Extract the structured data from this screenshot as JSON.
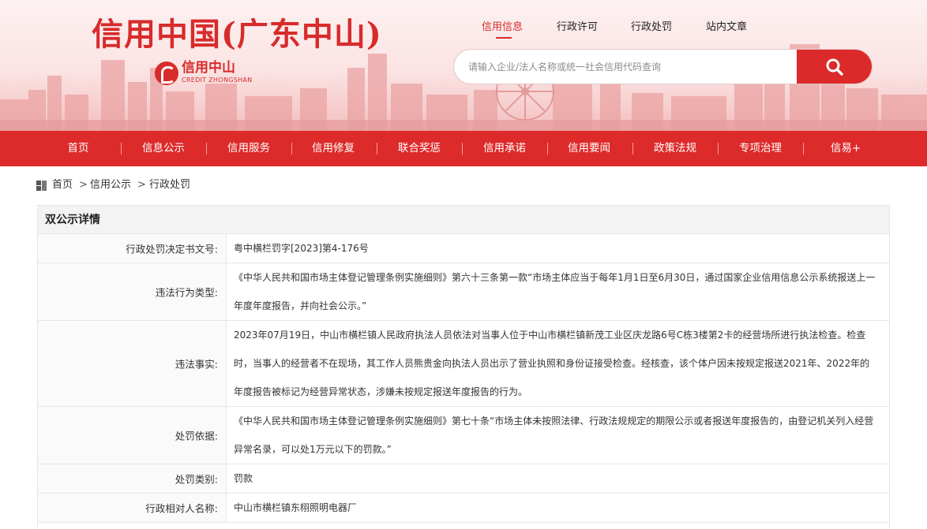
{
  "site": {
    "title": "信用中国(广东中山)",
    "logo_cn": "信用中山",
    "logo_en": "CREDIT ZHONGSHAN"
  },
  "top_links": [
    {
      "label": "信用信息",
      "active": true
    },
    {
      "label": "行政许可",
      "active": false
    },
    {
      "label": "行政处罚",
      "active": false
    },
    {
      "label": "站内文章",
      "active": false
    }
  ],
  "search": {
    "placeholder": "请输入企业/法人名称或统一社会信用代码查询",
    "icon": "search-icon"
  },
  "nav": [
    {
      "label": "首页"
    },
    {
      "label": "信息公示"
    },
    {
      "label": "信用服务"
    },
    {
      "label": "信用修复"
    },
    {
      "label": "联合奖惩"
    },
    {
      "label": "信用承诺"
    },
    {
      "label": "信用要闻"
    },
    {
      "label": "政策法规"
    },
    {
      "label": "专项治理"
    },
    {
      "label": "信易+"
    }
  ],
  "breadcrumb": {
    "icon": "grid-icon",
    "items": [
      "首页",
      "信用公示",
      "行政处罚"
    ],
    "separator": ">"
  },
  "panel": {
    "title": "双公示详情",
    "rows": [
      {
        "label": "行政处罚决定书文号:",
        "value": "粤中横栏罚字[2023]第4-176号"
      },
      {
        "label": "违法行为类型:",
        "value": "《中华人民共和国市场主体登记管理条例实施细则》第六十三条第一款“市场主体应当于每年1月1日至6月30日，通过国家企业信用信息公示系统报送上一年度年度报告，并向社会公示。”"
      },
      {
        "label": "违法事实:",
        "value": "2023年07月19日，中山市横栏镇人民政府执法人员依法对当事人位于中山市横栏镇新茂工业区庆龙路6号C栋3楼第2卡的经营场所进行执法检查。检查时，当事人的经营者不在现场，其工作人员熊贵金向执法人员出示了营业执照和身份证接受检查。经核查，该个体户因未按规定报送2021年、2022年的年度报告被标记为经营异常状态，涉嫌未按规定报送年度报告的行为。"
      },
      {
        "label": "处罚依据:",
        "value": "《中华人民共和国市场主体登记管理条例实施细则》第七十条“市场主体未按照法律、行政法规规定的期限公示或者报送年度报告的，由登记机关列入经营异常名录，可以处1万元以下的罚款。”"
      },
      {
        "label": "处罚类别:",
        "value": "罚款"
      },
      {
        "label": "行政相对人名称:",
        "value": "中山市横栏镇东栩照明电器厂"
      }
    ]
  },
  "colors": {
    "brand_red": "#dd2a2a",
    "banner_pink": "#fbe3e3",
    "row_border": "#e6e6e6"
  }
}
